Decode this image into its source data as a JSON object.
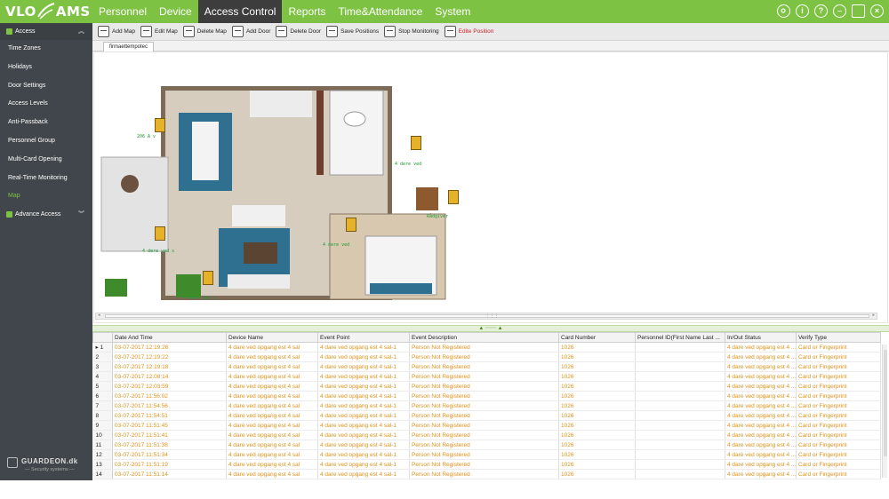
{
  "logo": {
    "text_left": "VLO",
    "text_right": "AMS"
  },
  "nav": {
    "items": [
      {
        "label": "Personnel"
      },
      {
        "label": "Device"
      },
      {
        "label": "Access Control"
      },
      {
        "label": "Reports"
      },
      {
        "label": "Time&Attendance"
      },
      {
        "label": "System"
      }
    ],
    "active": "Access Control"
  },
  "top_icons": [
    "settings-icon",
    "info-icon",
    "help-icon",
    "minimize-icon",
    "maximize-icon",
    "close-icon"
  ],
  "sidebar": {
    "section_access": "Access",
    "items": [
      {
        "label": "Time Zones"
      },
      {
        "label": "Holidays"
      },
      {
        "label": "Door Settings"
      },
      {
        "label": "Access Levels"
      },
      {
        "label": "Anti-Passback"
      },
      {
        "label": "Personnel Group"
      },
      {
        "label": "Multi-Card Opening"
      },
      {
        "label": "Real-Time Monitoring"
      },
      {
        "label": "Map"
      }
    ],
    "active_item": "Map",
    "section_advance": "Advance Access",
    "footer_name": "GUARDEON.dk",
    "footer_tagline": "— Security systems —"
  },
  "toolbar": {
    "buttons": [
      {
        "label": "Add Map",
        "icon": "add-map-icon"
      },
      {
        "label": "Edit Map",
        "icon": "edit-map-icon"
      },
      {
        "label": "Delete Map",
        "icon": "delete-map-icon"
      },
      {
        "label": "Add Door",
        "icon": "add-door-icon"
      },
      {
        "label": "Delete Door",
        "icon": "delete-door-icon"
      },
      {
        "label": "Save Positions",
        "icon": "save-positions-icon"
      },
      {
        "label": "Stop Monitoring",
        "icon": "stop-monitoring-icon"
      },
      {
        "label": "Edite Position",
        "icon": "edit-position-icon"
      }
    ]
  },
  "map_tab": {
    "label": "firmaettempotec"
  },
  "map_doors": [
    {
      "label": "206 A v",
      "icon": "door-icon"
    },
    {
      "label": "4 dere ved",
      "icon": "door-icon"
    },
    {
      "label": "Rådgiver",
      "icon": "door-icon"
    },
    {
      "label": "4 dere ved",
      "icon": "door-icon"
    },
    {
      "label": "4 dere ved s",
      "icon": "door-icon"
    },
    {
      "label": "4 dare ved s",
      "icon": "door-icon"
    }
  ],
  "splitter_grip": "▲ ⋯⋯ ▲",
  "events": {
    "columns": [
      "Date And Time",
      "Device Name",
      "Event Point",
      "Event Description",
      "Card Number",
      "Personnel ID(First Name Last ...",
      "In/Out Status",
      "Verify Type"
    ],
    "rows": [
      {
        "num": "1",
        "date": "03-07-2017 12:19:26",
        "device": "4 dare ved opgang est 4 sal",
        "point": "4 dare ved opgang est 4 sal-1",
        "desc": "Person Not Registered",
        "card": "1026",
        "person": "",
        "status": "4 dare ved opgang est 4 ...",
        "verify": "Card or Fingerprint"
      },
      {
        "num": "2",
        "date": "03-07-2017 12:19:22",
        "device": "4 dare ved opgang est 4 sal",
        "point": "4 dare ved opgang est 4 sal-1",
        "desc": "Person Not Registered",
        "card": "1026",
        "person": "",
        "status": "4 dare ved opgang est 4 ...",
        "verify": "Card or Fingerprint"
      },
      {
        "num": "3",
        "date": "03-07-2017 12:19:18",
        "device": "4 dare ved opgang est 4 sal",
        "point": "4 dare ved opgang est 4 sal-1",
        "desc": "Person Not Registered",
        "card": "1026",
        "person": "",
        "status": "4 dare ved opgang est 4 ...",
        "verify": "Card or Fingerprint"
      },
      {
        "num": "4",
        "date": "03-07-2017 12:08:14",
        "device": "4 dare ved opgang est 4 sal",
        "point": "4 dare ved opgang est 4 sal-1",
        "desc": "Person Not Registered",
        "card": "1026",
        "person": "",
        "status": "4 dare ved opgang est 4 ...",
        "verify": "Card or Fingerprint"
      },
      {
        "num": "5",
        "date": "03-07-2017 12:03:59",
        "device": "4 dare ved opgang est 4 sal",
        "point": "4 dare ved opgang est 4 sal-1",
        "desc": "Person Not Registered",
        "card": "1026",
        "person": "",
        "status": "4 dare ved opgang est 4 ...",
        "verify": "Card or Fingerprint"
      },
      {
        "num": "6",
        "date": "03-07-2017 11:56:02",
        "device": "4 dare ved opgang est 4 sal",
        "point": "4 dare ved opgang est 4 sal-1",
        "desc": "Person Not Registered",
        "card": "1026",
        "person": "",
        "status": "4 dare ved opgang est 4 ...",
        "verify": "Card or Fingerprint"
      },
      {
        "num": "7",
        "date": "03-07-2017 11:54:56",
        "device": "4 dare ved opgang est 4 sal",
        "point": "4 dare ved opgang est 4 sal-1",
        "desc": "Person Not Registered",
        "card": "1026",
        "person": "",
        "status": "4 dare ved opgang est 4 ...",
        "verify": "Card or Fingerprint"
      },
      {
        "num": "8",
        "date": "03-07-2017 11:54:51",
        "device": "4 dare ved opgang est 4 sal",
        "point": "4 dare ved opgang est 4 sal-1",
        "desc": "Person Not Registered",
        "card": "1026",
        "person": "",
        "status": "4 dare ved opgang est 4 ...",
        "verify": "Card or Fingerprint"
      },
      {
        "num": "9",
        "date": "03-07-2017 11:51:45",
        "device": "4 dare ved opgang est 4 sal",
        "point": "4 dare ved opgang est 4 sal-1",
        "desc": "Person Not Registered",
        "card": "1026",
        "person": "",
        "status": "4 dare ved opgang est 4 ...",
        "verify": "Card or Fingerprint"
      },
      {
        "num": "10",
        "date": "03-07-2017 11:51:41",
        "device": "4 dare ved opgang est 4 sal",
        "point": "4 dare ved opgang est 4 sal-1",
        "desc": "Person Not Registered",
        "card": "1026",
        "person": "",
        "status": "4 dare ved opgang est 4 ...",
        "verify": "Card or Fingerprint"
      },
      {
        "num": "11",
        "date": "03-07-2017 11:51:38",
        "device": "4 dare ved opgang est 4 sal",
        "point": "4 dare ved opgang est 4 sal-1",
        "desc": "Person Not Registered",
        "card": "1026",
        "person": "",
        "status": "4 dare ved opgang est 4 ...",
        "verify": "Card or Fingerprint"
      },
      {
        "num": "12",
        "date": "03-07-2017 11:51:34",
        "device": "4 dare ved opgang est 4 sal",
        "point": "4 dare ved opgang est 4 sal-1",
        "desc": "Person Not Registered",
        "card": "1026",
        "person": "",
        "status": "4 dare ved opgang est 4 ...",
        "verify": "Card or Fingerprint"
      },
      {
        "num": "13",
        "date": "03-07-2017 11:51:19",
        "device": "4 dare ved opgang est 4 sal",
        "point": "4 dare ved opgang est 4 sal-1",
        "desc": "Person Not Registered",
        "card": "1026",
        "person": "",
        "status": "4 dare ved opgang est 4 ...",
        "verify": "Card or Fingerprint"
      },
      {
        "num": "14",
        "date": "03-07-2017 11:51:14",
        "device": "4 dare ved opgang est 4 sal",
        "point": "4 dare ved opgang est 4 sal-1",
        "desc": "Person Not Registered",
        "card": "1026",
        "person": "",
        "status": "4 dare ved opgang est 4 ...",
        "verify": "Card or Fingerprint"
      }
    ]
  },
  "colors": {
    "brand_green": "#7dc242",
    "nav_active": "#3d3d3d",
    "sidebar_bg": "#40464b",
    "event_text": "#e0921b",
    "toolbar_warning": "#d0262d"
  }
}
